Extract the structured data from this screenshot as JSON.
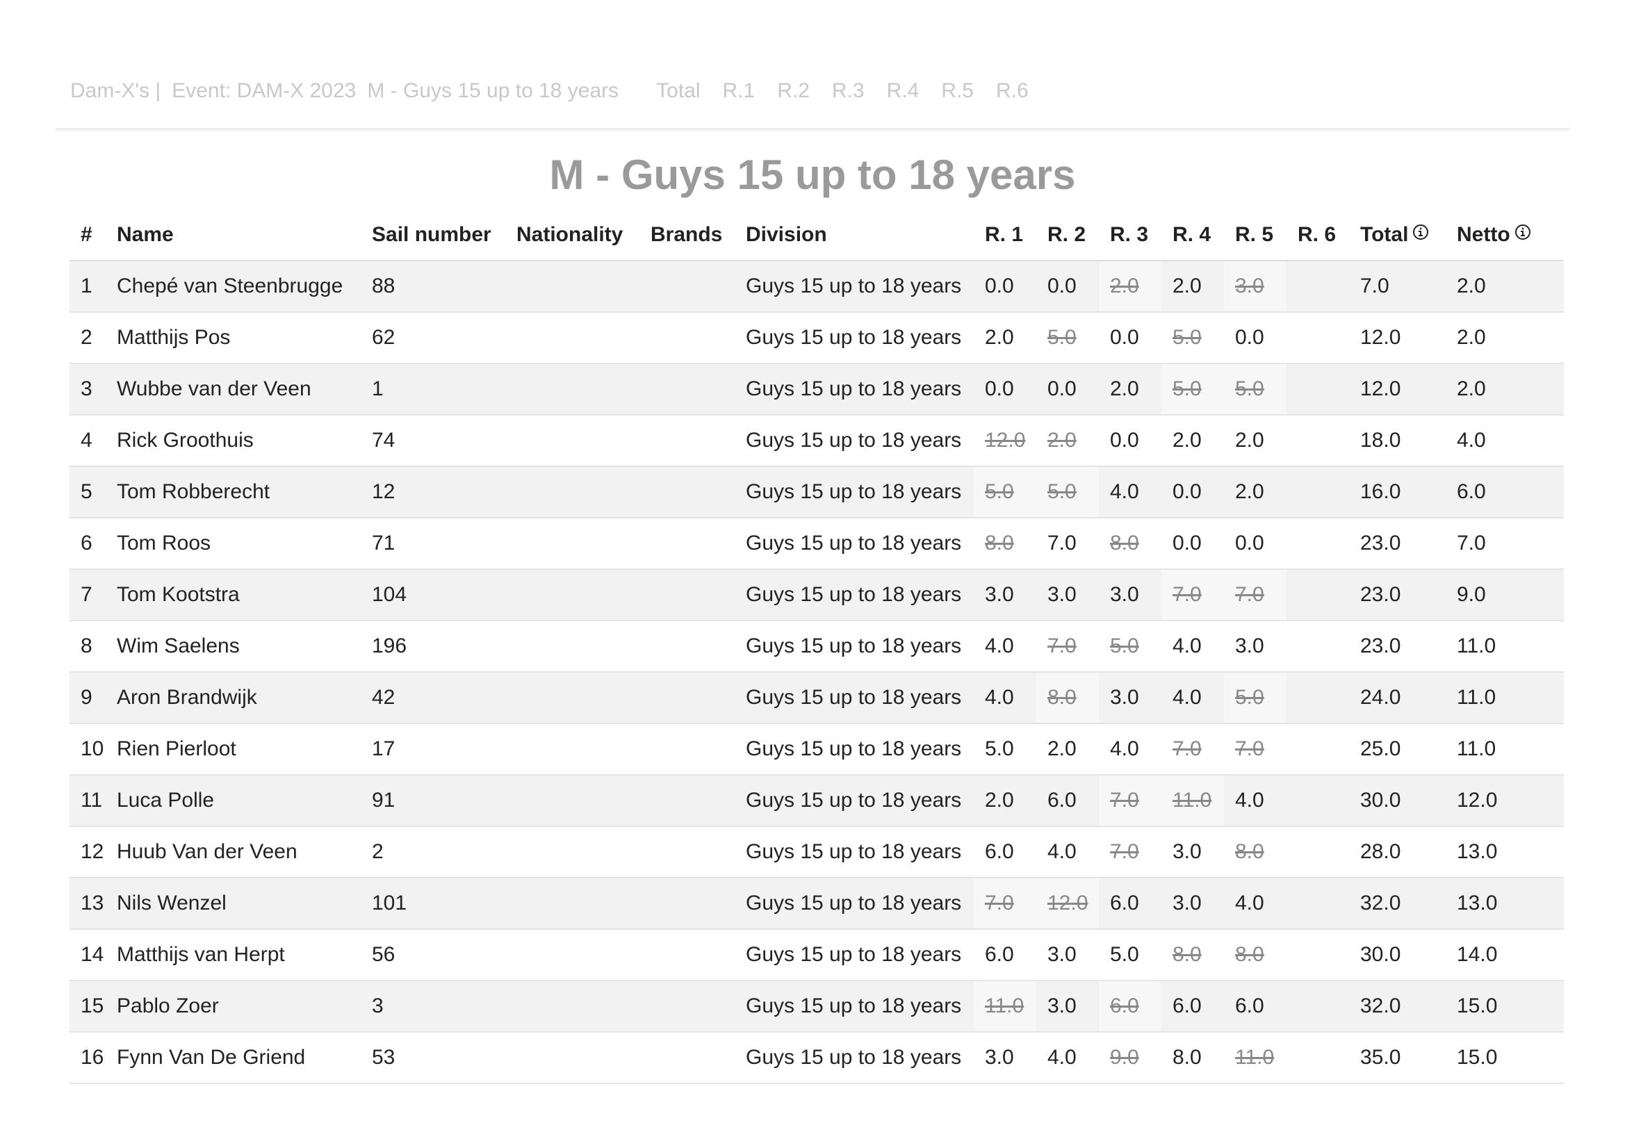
{
  "topnav": {
    "brand": "Dam-X's |",
    "event": "Event: DAM-X 2023",
    "division": "M - Guys 15 up to 18 years",
    "links": [
      "Total",
      "R.1",
      "R.2",
      "R.3",
      "R.4",
      "R.5",
      "R.6"
    ]
  },
  "page": {
    "title": "M - Guys 15 up to 18 years"
  },
  "table": {
    "headers": {
      "rank": "#",
      "name": "Name",
      "sail": "Sail number",
      "nationality": "Nationality",
      "brands": "Brands",
      "division": "Division",
      "r1": "R. 1",
      "r2": "R. 2",
      "r3": "R. 3",
      "r4": "R. 4",
      "r5": "R. 5",
      "r6": "R. 6",
      "total": "Total",
      "netto": "Netto"
    },
    "rows": [
      {
        "rank": "1",
        "name": "Chepé van Steenbrugge",
        "sail": "88",
        "nationality": "",
        "brands": "",
        "division": "Guys 15 up to 18 years",
        "races": [
          {
            "v": "0.0",
            "d": false
          },
          {
            "v": "0.0",
            "d": false
          },
          {
            "v": "2.0",
            "d": true
          },
          {
            "v": "2.0",
            "d": false
          },
          {
            "v": "3.0",
            "d": true
          },
          {
            "v": "",
            "d": false
          }
        ],
        "total": "7.0",
        "netto": "2.0"
      },
      {
        "rank": "2",
        "name": "Matthijs Pos",
        "sail": "62",
        "nationality": "",
        "brands": "",
        "division": "Guys 15 up to 18 years",
        "races": [
          {
            "v": "2.0",
            "d": false
          },
          {
            "v": "5.0",
            "d": true
          },
          {
            "v": "0.0",
            "d": false
          },
          {
            "v": "5.0",
            "d": true
          },
          {
            "v": "0.0",
            "d": false
          },
          {
            "v": "",
            "d": false
          }
        ],
        "total": "12.0",
        "netto": "2.0"
      },
      {
        "rank": "3",
        "name": "Wubbe van der Veen",
        "sail": "1",
        "nationality": "",
        "brands": "",
        "division": "Guys 15 up to 18 years",
        "races": [
          {
            "v": "0.0",
            "d": false
          },
          {
            "v": "0.0",
            "d": false
          },
          {
            "v": "2.0",
            "d": false
          },
          {
            "v": "5.0",
            "d": true
          },
          {
            "v": "5.0",
            "d": true
          },
          {
            "v": "",
            "d": false
          }
        ],
        "total": "12.0",
        "netto": "2.0"
      },
      {
        "rank": "4",
        "name": "Rick Groothuis",
        "sail": "74",
        "nationality": "",
        "brands": "",
        "division": "Guys 15 up to 18 years",
        "races": [
          {
            "v": "12.0",
            "d": true
          },
          {
            "v": "2.0",
            "d": true
          },
          {
            "v": "0.0",
            "d": false
          },
          {
            "v": "2.0",
            "d": false
          },
          {
            "v": "2.0",
            "d": false
          },
          {
            "v": "",
            "d": false
          }
        ],
        "total": "18.0",
        "netto": "4.0"
      },
      {
        "rank": "5",
        "name": "Tom Robberecht",
        "sail": "12",
        "nationality": "",
        "brands": "",
        "division": "Guys 15 up to 18 years",
        "races": [
          {
            "v": "5.0",
            "d": true
          },
          {
            "v": "5.0",
            "d": true
          },
          {
            "v": "4.0",
            "d": false
          },
          {
            "v": "0.0",
            "d": false
          },
          {
            "v": "2.0",
            "d": false
          },
          {
            "v": "",
            "d": false
          }
        ],
        "total": "16.0",
        "netto": "6.0"
      },
      {
        "rank": "6",
        "name": "Tom Roos",
        "sail": "71",
        "nationality": "",
        "brands": "",
        "division": "Guys 15 up to 18 years",
        "races": [
          {
            "v": "8.0",
            "d": true
          },
          {
            "v": "7.0",
            "d": false
          },
          {
            "v": "8.0",
            "d": true
          },
          {
            "v": "0.0",
            "d": false
          },
          {
            "v": "0.0",
            "d": false
          },
          {
            "v": "",
            "d": false
          }
        ],
        "total": "23.0",
        "netto": "7.0"
      },
      {
        "rank": "7",
        "name": "Tom Kootstra",
        "sail": "104",
        "nationality": "",
        "brands": "",
        "division": "Guys 15 up to 18 years",
        "races": [
          {
            "v": "3.0",
            "d": false
          },
          {
            "v": "3.0",
            "d": false
          },
          {
            "v": "3.0",
            "d": false
          },
          {
            "v": "7.0",
            "d": true
          },
          {
            "v": "7.0",
            "d": true
          },
          {
            "v": "",
            "d": false
          }
        ],
        "total": "23.0",
        "netto": "9.0"
      },
      {
        "rank": "8",
        "name": "Wim Saelens",
        "sail": "196",
        "nationality": "",
        "brands": "",
        "division": "Guys 15 up to 18 years",
        "races": [
          {
            "v": "4.0",
            "d": false
          },
          {
            "v": "7.0",
            "d": true
          },
          {
            "v": "5.0",
            "d": true
          },
          {
            "v": "4.0",
            "d": false
          },
          {
            "v": "3.0",
            "d": false
          },
          {
            "v": "",
            "d": false
          }
        ],
        "total": "23.0",
        "netto": "11.0"
      },
      {
        "rank": "9",
        "name": "Aron Brandwijk",
        "sail": "42",
        "nationality": "",
        "brands": "",
        "division": "Guys 15 up to 18 years",
        "races": [
          {
            "v": "4.0",
            "d": false
          },
          {
            "v": "8.0",
            "d": true
          },
          {
            "v": "3.0",
            "d": false
          },
          {
            "v": "4.0",
            "d": false
          },
          {
            "v": "5.0",
            "d": true
          },
          {
            "v": "",
            "d": false
          }
        ],
        "total": "24.0",
        "netto": "11.0"
      },
      {
        "rank": "10",
        "name": "Rien Pierloot",
        "sail": "17",
        "nationality": "",
        "brands": "",
        "division": "Guys 15 up to 18 years",
        "races": [
          {
            "v": "5.0",
            "d": false
          },
          {
            "v": "2.0",
            "d": false
          },
          {
            "v": "4.0",
            "d": false
          },
          {
            "v": "7.0",
            "d": true
          },
          {
            "v": "7.0",
            "d": true
          },
          {
            "v": "",
            "d": false
          }
        ],
        "total": "25.0",
        "netto": "11.0"
      },
      {
        "rank": "11",
        "name": "Luca Polle",
        "sail": "91",
        "nationality": "",
        "brands": "",
        "division": "Guys 15 up to 18 years",
        "races": [
          {
            "v": "2.0",
            "d": false
          },
          {
            "v": "6.0",
            "d": false
          },
          {
            "v": "7.0",
            "d": true
          },
          {
            "v": "11.0",
            "d": true
          },
          {
            "v": "4.0",
            "d": false
          },
          {
            "v": "",
            "d": false
          }
        ],
        "total": "30.0",
        "netto": "12.0"
      },
      {
        "rank": "12",
        "name": "Huub Van der Veen",
        "sail": "2",
        "nationality": "",
        "brands": "",
        "division": "Guys 15 up to 18 years",
        "races": [
          {
            "v": "6.0",
            "d": false
          },
          {
            "v": "4.0",
            "d": false
          },
          {
            "v": "7.0",
            "d": true
          },
          {
            "v": "3.0",
            "d": false
          },
          {
            "v": "8.0",
            "d": true
          },
          {
            "v": "",
            "d": false
          }
        ],
        "total": "28.0",
        "netto": "13.0"
      },
      {
        "rank": "13",
        "name": "Nils Wenzel",
        "sail": "101",
        "nationality": "",
        "brands": "",
        "division": "Guys 15 up to 18 years",
        "races": [
          {
            "v": "7.0",
            "d": true
          },
          {
            "v": "12.0",
            "d": true
          },
          {
            "v": "6.0",
            "d": false
          },
          {
            "v": "3.0",
            "d": false
          },
          {
            "v": "4.0",
            "d": false
          },
          {
            "v": "",
            "d": false
          }
        ],
        "total": "32.0",
        "netto": "13.0"
      },
      {
        "rank": "14",
        "name": "Matthijs van Herpt",
        "sail": "56",
        "nationality": "",
        "brands": "",
        "division": "Guys 15 up to 18 years",
        "races": [
          {
            "v": "6.0",
            "d": false
          },
          {
            "v": "3.0",
            "d": false
          },
          {
            "v": "5.0",
            "d": false
          },
          {
            "v": "8.0",
            "d": true
          },
          {
            "v": "8.0",
            "d": true
          },
          {
            "v": "",
            "d": false
          }
        ],
        "total": "30.0",
        "netto": "14.0"
      },
      {
        "rank": "15",
        "name": "Pablo Zoer",
        "sail": "3",
        "nationality": "",
        "brands": "",
        "division": "Guys 15 up to 18 years",
        "races": [
          {
            "v": "11.0",
            "d": true
          },
          {
            "v": "3.0",
            "d": false
          },
          {
            "v": "6.0",
            "d": true
          },
          {
            "v": "6.0",
            "d": false
          },
          {
            "v": "6.0",
            "d": false
          },
          {
            "v": "",
            "d": false
          }
        ],
        "total": "32.0",
        "netto": "15.0"
      },
      {
        "rank": "16",
        "name": "Fynn Van De Griend",
        "sail": "53",
        "nationality": "",
        "brands": "",
        "division": "Guys 15 up to 18 years",
        "races": [
          {
            "v": "3.0",
            "d": false
          },
          {
            "v": "4.0",
            "d": false
          },
          {
            "v": "9.0",
            "d": true
          },
          {
            "v": "8.0",
            "d": false
          },
          {
            "v": "11.0",
            "d": true
          },
          {
            "v": "",
            "d": false
          }
        ],
        "total": "35.0",
        "netto": "15.0"
      }
    ]
  }
}
